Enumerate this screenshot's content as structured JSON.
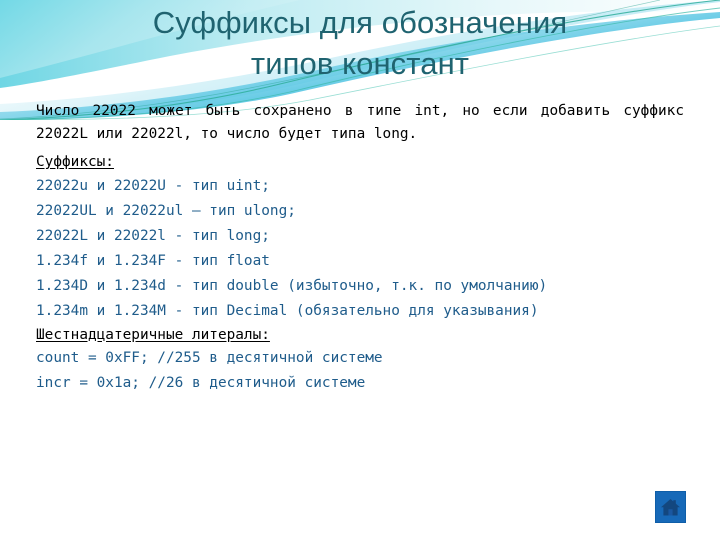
{
  "slide": {
    "title_lines": [
      "Суффиксы для обозначения",
      "типов констант"
    ],
    "intro_paragraph": "Число 22022 может быть сохранено в типе int, но если добавить суффикс 22022L или 22022l, то число будет типа long.",
    "sections": [
      {
        "heading": "Суффиксы:",
        "items": [
          "22022u и 22022U - тип uint;",
          "22022UL и 22022ul — тип ulong;",
          "22022L и 22022l - тип long;",
          "1.234f и 1.234F - тип float",
          "1.234D и 1.234d - тип double (избыточно, т.к. по умолчанию)",
          "1.234m и 1.234M - тип Decimal (обязательно для указывания)"
        ]
      },
      {
        "heading": "Шестнадцатеричные литералы:",
        "items": [
          "count = 0xFF; //255 в десятичной системе",
          "incr = 0x1a; //26 в десятичной системе"
        ]
      }
    ]
  },
  "controls": {
    "home_icon": "home-icon"
  },
  "colors": {
    "title": "#1f6370",
    "body_text": "#000000",
    "code_text": "#1f5c8b",
    "banner_cyan": "#8fdfe9",
    "banner_ribbon": "#5cc6e0",
    "banner_line": "#2fae9b",
    "home_button_bg": "#1769b8",
    "home_glyph": "#13477f",
    "background": "#ffffff"
  }
}
